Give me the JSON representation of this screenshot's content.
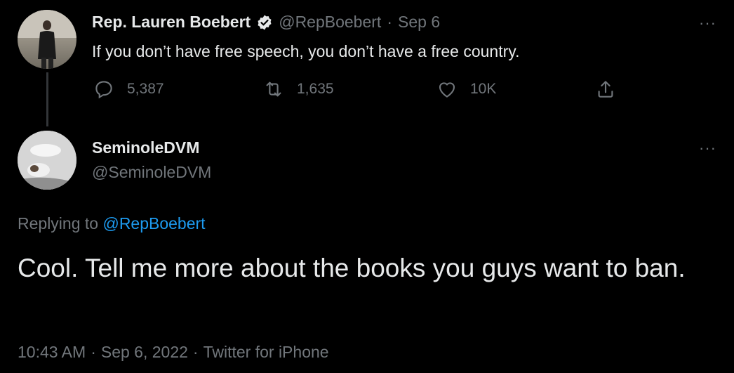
{
  "parent_tweet": {
    "display_name": "Rep. Lauren Boebert",
    "handle": "@RepBoebert",
    "separator": "·",
    "date": "Sep 6",
    "text": "If you don’t have free speech, you don’t have a free country.",
    "replies": "5,387",
    "retweets": "1,635",
    "likes": "10K",
    "more": "···"
  },
  "reply_tweet": {
    "display_name": "SeminoleDVM",
    "handle": "@SeminoleDVM",
    "more": "···",
    "replying_prefix": "Replying to",
    "replying_to": "@RepBoebert",
    "text": "Cool. Tell me more about the books you guys want to ban.",
    "time": "10:43 AM",
    "separator": "·",
    "date": "Sep 6, 2022",
    "client": "Twitter for iPhone"
  },
  "colors": {
    "background": "#000000",
    "text": "#e7e9ea",
    "muted": "#71767b",
    "link": "#1d9bf0"
  }
}
